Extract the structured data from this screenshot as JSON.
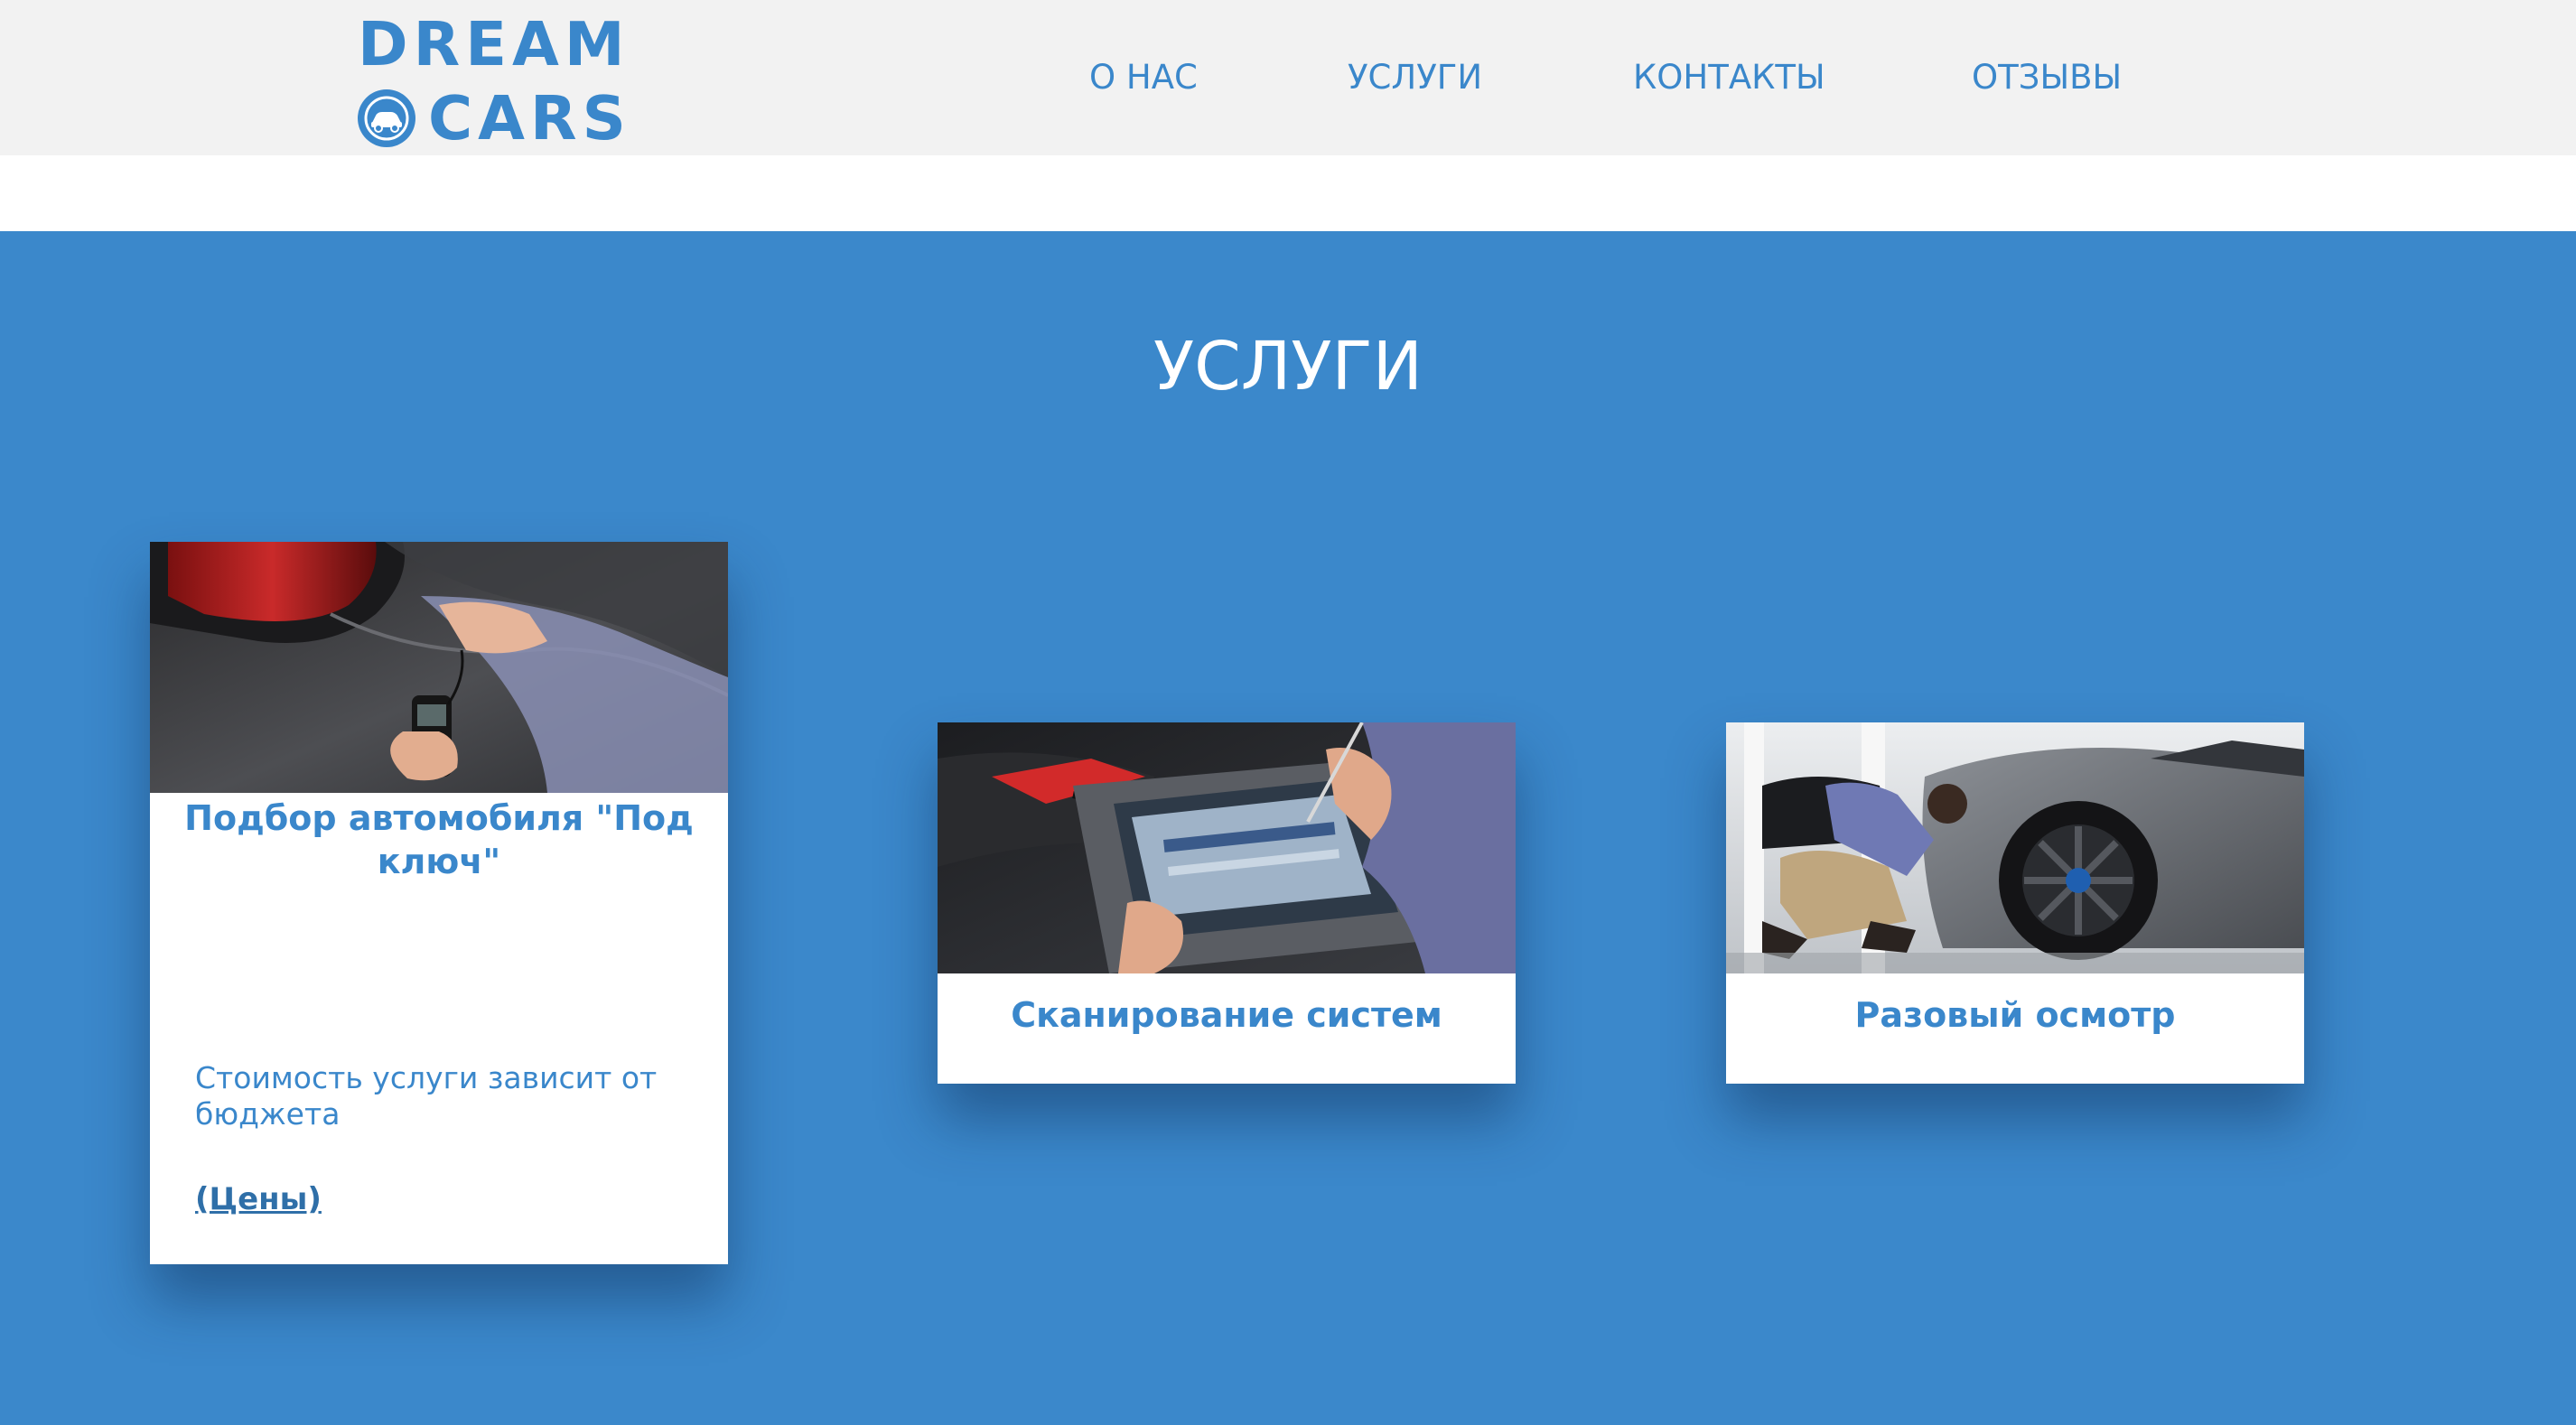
{
  "header": {
    "logo_line1": "DREAM",
    "logo_line2": "CARS",
    "nav": [
      "О НАС",
      "УСЛУГИ",
      "КОНТАКТЫ",
      "ОТЗЫВЫ"
    ]
  },
  "services": {
    "title": "УСЛУГИ",
    "cards": [
      {
        "title": "Подбор автомобиля \"Под ключ\"",
        "description": "Стоимость услуги зависит от бюджета",
        "link": "(Цены)"
      },
      {
        "title": "Сканирование систем"
      },
      {
        "title": "Разовый осмотр"
      }
    ]
  },
  "colors": {
    "brand_blue": "#3a87cb",
    "section_bg": "#3b88cb",
    "header_bg": "#f2f2f2"
  },
  "icons": [
    "car-logo-icon"
  ]
}
